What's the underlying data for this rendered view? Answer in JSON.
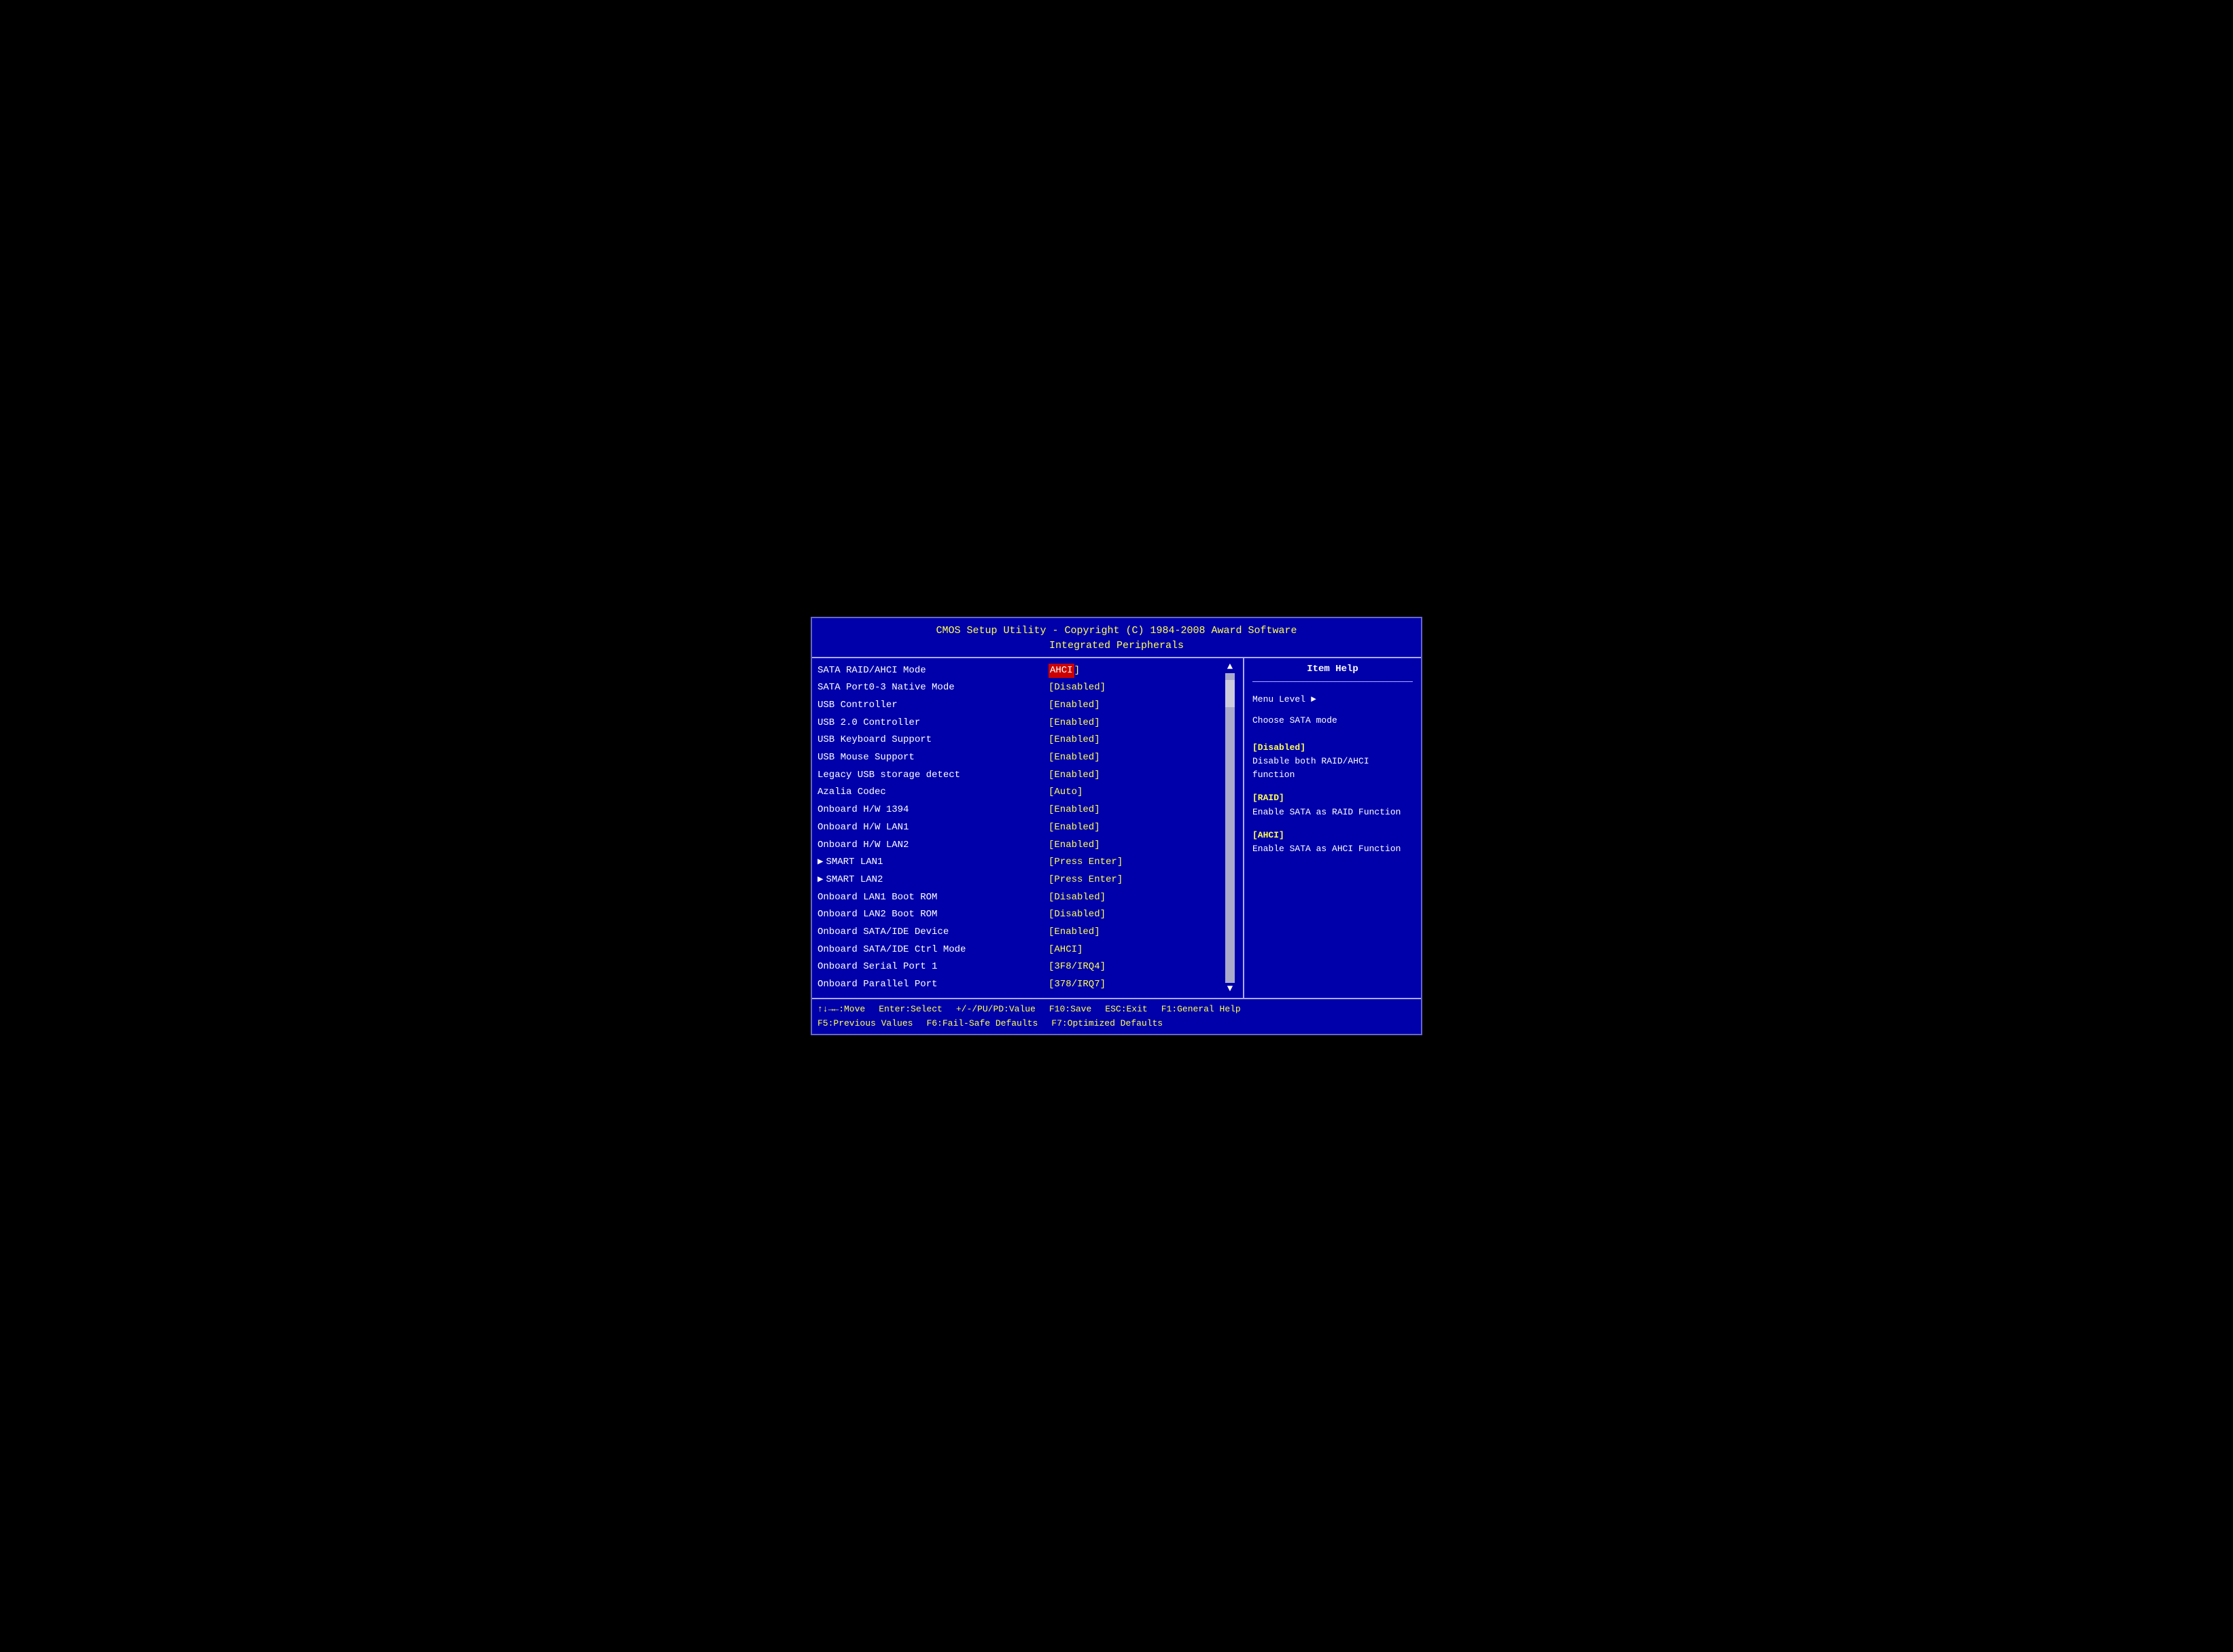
{
  "title": {
    "line1": "CMOS Setup Utility - Copyright (C) 1984-2008 Award Software",
    "line2": "Integrated Peripherals"
  },
  "settings": [
    {
      "name": "SATA RAID/AHCI Mode",
      "value": "AHCI",
      "highlight": true,
      "arrow": false
    },
    {
      "name": "SATA Port0-3 Native Mode",
      "value": "[Disabled]",
      "highlight": false,
      "arrow": false
    },
    {
      "name": "USB Controller",
      "value": "[Enabled]",
      "highlight": false,
      "arrow": false
    },
    {
      "name": "USB 2.0 Controller",
      "value": "[Enabled]",
      "highlight": false,
      "arrow": false
    },
    {
      "name": "USB Keyboard Support",
      "value": "[Enabled]",
      "highlight": false,
      "arrow": false
    },
    {
      "name": "USB Mouse Support",
      "value": "[Enabled]",
      "highlight": false,
      "arrow": false
    },
    {
      "name": "Legacy USB storage detect",
      "value": "[Enabled]",
      "highlight": false,
      "arrow": false
    },
    {
      "name": "Azalia Codec",
      "value": "[Auto]",
      "highlight": false,
      "arrow": false
    },
    {
      "name": "Onboard H/W 1394",
      "value": "[Enabled]",
      "highlight": false,
      "arrow": false
    },
    {
      "name": "Onboard H/W LAN1",
      "value": "[Enabled]",
      "highlight": false,
      "arrow": false
    },
    {
      "name": "Onboard H/W LAN2",
      "value": "[Enabled]",
      "highlight": false,
      "arrow": false
    },
    {
      "name": "SMART LAN1",
      "value": "[Press Enter]",
      "highlight": false,
      "arrow": true
    },
    {
      "name": "SMART LAN2",
      "value": "[Press Enter]",
      "highlight": false,
      "arrow": true
    },
    {
      "name": "Onboard LAN1 Boot ROM",
      "value": "[Disabled]",
      "highlight": false,
      "arrow": false
    },
    {
      "name": "Onboard LAN2 Boot ROM",
      "value": "[Disabled]",
      "highlight": false,
      "arrow": false
    },
    {
      "name": "Onboard SATA/IDE Device",
      "value": "[Enabled]",
      "highlight": false,
      "arrow": false
    },
    {
      "name": "Onboard SATA/IDE Ctrl Mode",
      "value": "[AHCI]",
      "highlight": false,
      "arrow": false
    },
    {
      "name": "Onboard Serial Port 1",
      "value": "[3F8/IRQ4]",
      "highlight": false,
      "arrow": false
    },
    {
      "name": "Onboard Parallel Port",
      "value": "[378/IRQ7]",
      "highlight": false,
      "arrow": false
    }
  ],
  "help_panel": {
    "title": "Item Help",
    "menu_level": "Menu Level",
    "description": "Choose SATA mode",
    "options": [
      {
        "label": "[Disabled]",
        "text": "Disable both RAID/AHCI function"
      },
      {
        "label": "[RAID]",
        "text": "Enable SATA as RAID Function"
      },
      {
        "label": "[AHCI]",
        "text": "Enable SATA as AHCI Function"
      }
    ]
  },
  "footer": {
    "row1": [
      {
        "key": "↑↓→←:Move",
        "desc": ""
      },
      {
        "key": "Enter:Select",
        "desc": ""
      },
      {
        "key": "+/-/PU/PD:Value",
        "desc": ""
      },
      {
        "key": "F10:Save",
        "desc": ""
      },
      {
        "key": "ESC:Exit",
        "desc": ""
      },
      {
        "key": "F1:General Help",
        "desc": ""
      }
    ],
    "row2": [
      {
        "key": "F5:Previous Values",
        "desc": ""
      },
      {
        "key": "F6:Fail-Safe Defaults",
        "desc": ""
      },
      {
        "key": "F7:Optimized Defaults",
        "desc": ""
      }
    ]
  }
}
